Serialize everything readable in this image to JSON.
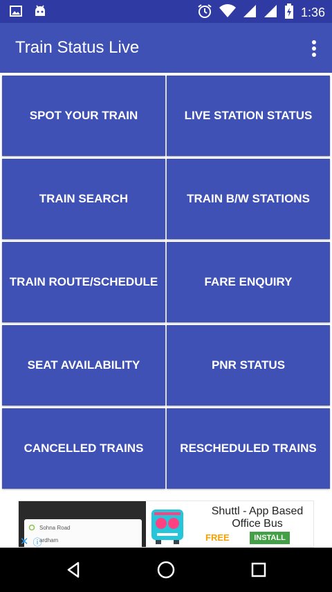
{
  "status_bar": {
    "time": "1:36",
    "icons": [
      "image-icon",
      "android-icon",
      "alarm-icon",
      "wifi-icon",
      "signal-icon",
      "signal-icon-2",
      "battery-icon"
    ]
  },
  "app_bar": {
    "title": "Train Status Live",
    "menu_icon": "overflow-menu-icon"
  },
  "menu": {
    "items": [
      {
        "label": "SPOT YOUR TRAIN"
      },
      {
        "label": "LIVE STATION STATUS"
      },
      {
        "label": "TRAIN SEARCH"
      },
      {
        "label": "TRAIN B/W STATIONS"
      },
      {
        "label": "TRAIN ROUTE/SCHEDULE"
      },
      {
        "label": "FARE ENQUIRY"
      },
      {
        "label": "SEAT AVAILABILITY"
      },
      {
        "label": "PNR STATUS"
      },
      {
        "label": "CANCELLED TRAINS"
      },
      {
        "label": "RESCHEDULED TRAINS"
      }
    ]
  },
  "ad": {
    "map_line_1": "Sohna Road",
    "map_line_2": "ardham",
    "headline": "Shuttl - App Based Office Bus",
    "price": "FREE",
    "install_label": "INSTALL",
    "close_symbol": "✕",
    "info_symbol": "ⓘ"
  },
  "colors": {
    "primary": "#3f51b5",
    "status_bar": "#2f3aa3",
    "install": "#43a047",
    "free": "#f5a100"
  },
  "nav_bar": {
    "icons": [
      "back-icon",
      "home-icon",
      "recents-icon"
    ]
  }
}
